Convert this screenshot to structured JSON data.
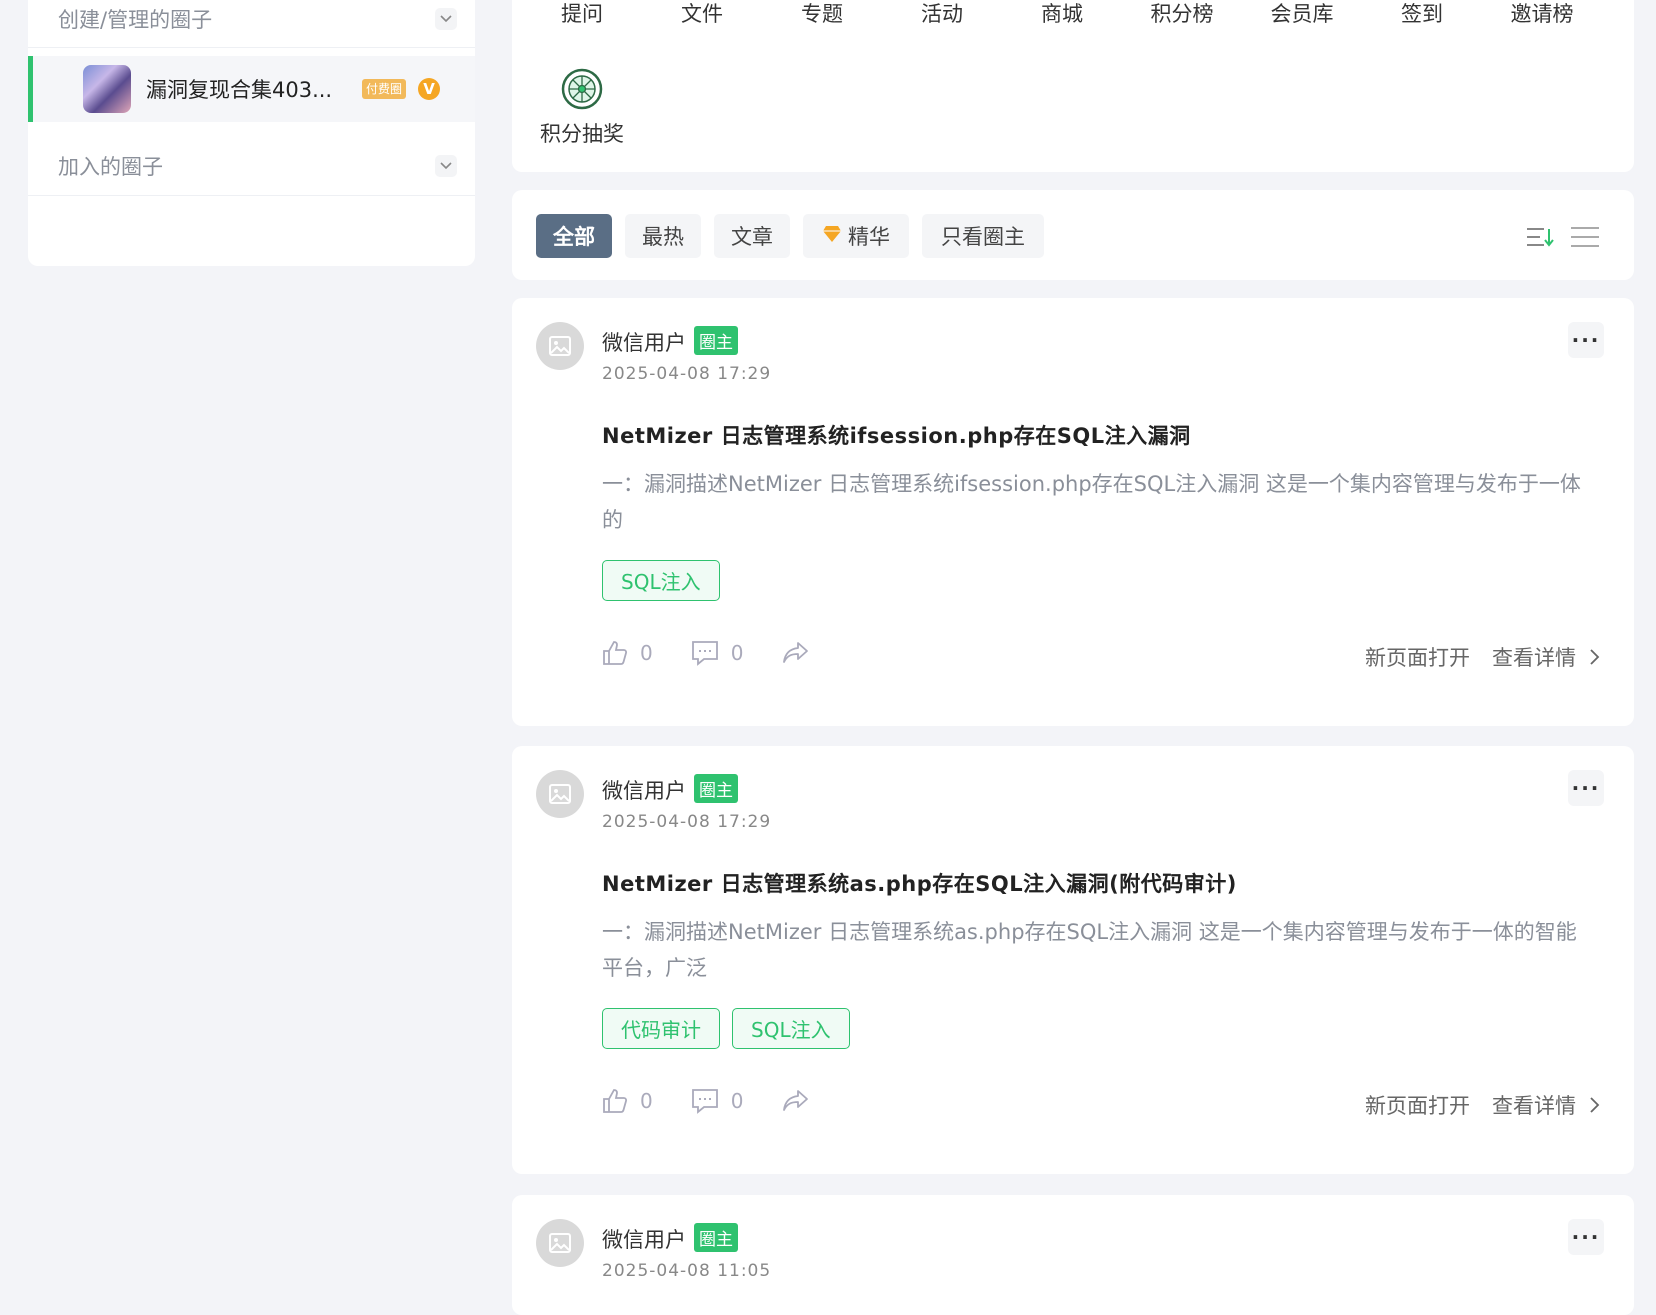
{
  "sidebar": {
    "manage_section": "创建/管理的圈子",
    "circle_name": "漏洞复现合集403...",
    "paid_badge": "付费圈",
    "v_badge": "V",
    "joined_section": "加入的圈子"
  },
  "nav": {
    "items": [
      "提问",
      "文件",
      "专题",
      "活动",
      "商城",
      "积分榜",
      "会员库",
      "签到",
      "邀请榜"
    ],
    "lottery": "积分抽奖"
  },
  "filters": {
    "tabs": [
      "全部",
      "最热",
      "文章",
      "精华",
      "只看圈主"
    ],
    "active": "全部"
  },
  "posts": [
    {
      "user": "微信用户",
      "badge": "圈主",
      "time": "2025-04-08 17:29",
      "title": "NetMizer 日志管理系统ifsession.php存在SQL注入漏洞",
      "desc": "一：漏洞描述NetMizer 日志管理系统ifsession.php存在SQL注入漏洞 这是一个集内容管理与发布于一体的",
      "tags": [
        "SQL注入"
      ],
      "likes": "0",
      "comments": "0",
      "open_new": "新页面打开",
      "view_detail": "查看详情"
    },
    {
      "user": "微信用户",
      "badge": "圈主",
      "time": "2025-04-08 17:29",
      "title": "NetMizer 日志管理系统as.php存在SQL注入漏洞(附代码审计)",
      "desc": "一：漏洞描述NetMizer 日志管理系统as.php存在SQL注入漏洞 这是一个集内容管理与发布于一体的智能平台，广泛",
      "tags": [
        "代码审计",
        "SQL注入"
      ],
      "likes": "0",
      "comments": "0",
      "open_new": "新页面打开",
      "view_detail": "查看详情"
    },
    {
      "user": "微信用户",
      "badge": "圈主",
      "time": "2025-04-08 11:05"
    }
  ],
  "colors": {
    "accent": "#2fc26f",
    "active_tab": "#5a6e85",
    "paid": "#f2b95a",
    "vip": "#f5a623"
  },
  "icons": [
    "chevron-down-icon",
    "lottery-wheel-icon",
    "sort-icon",
    "list-icon",
    "image-placeholder-icon",
    "more-icon",
    "like-icon",
    "comment-icon",
    "share-icon",
    "chevron-right-icon",
    "diamond-icon"
  ]
}
